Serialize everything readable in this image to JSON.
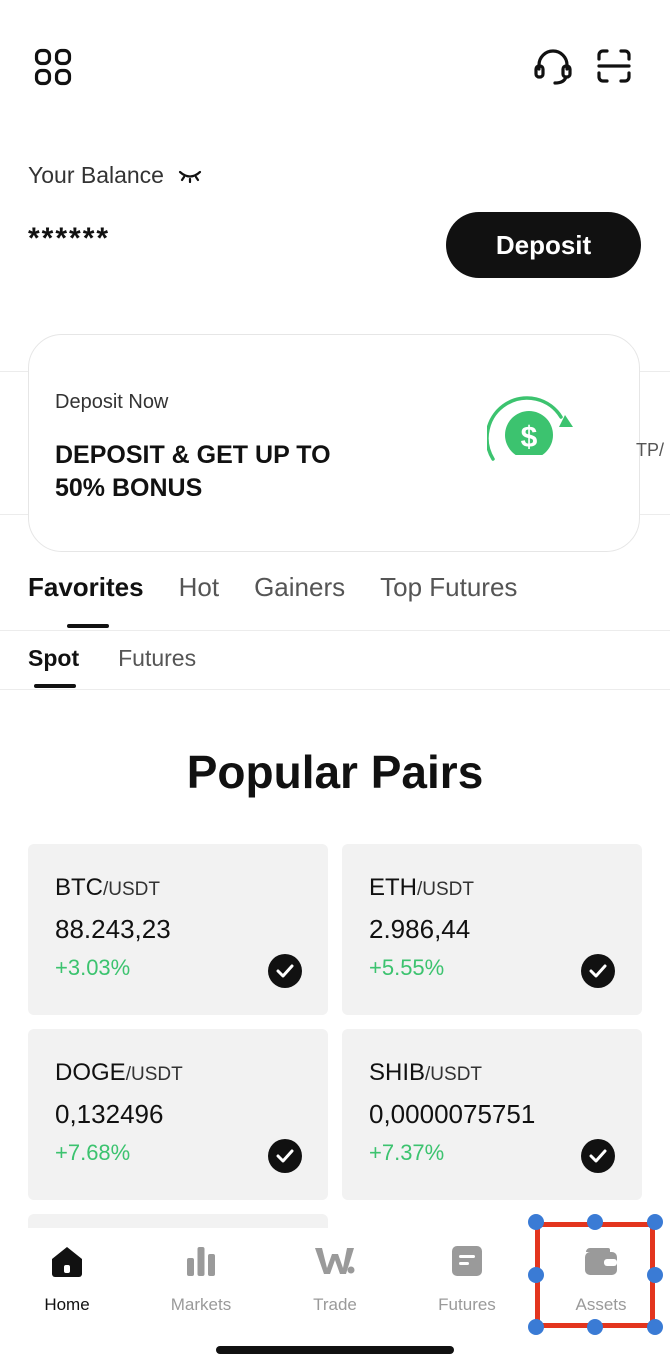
{
  "header": {
    "menu_icon": "grid-icon",
    "support_icon": "headset-icon",
    "scan_icon": "scan-icon"
  },
  "balance": {
    "label": "Your Balance",
    "hidden_value": "******",
    "visibility_icon": "eye-closed-icon",
    "deposit_label": "Deposit"
  },
  "promo": {
    "subtitle": "Deposit Now",
    "title": "DEPOSIT & GET UP TO 50% BONUS",
    "icon": "dollar-coin-icon",
    "next_edge_text": "TP/"
  },
  "tabs": [
    {
      "label": "Favorites",
      "active": true
    },
    {
      "label": "Hot",
      "active": false
    },
    {
      "label": "Gainers",
      "active": false
    },
    {
      "label": "Top Futures",
      "active": false
    }
  ],
  "subtabs": [
    {
      "label": "Spot",
      "active": true
    },
    {
      "label": "Futures",
      "active": false
    }
  ],
  "section_title": "Popular Pairs",
  "pairs": [
    {
      "base": "BTC",
      "quote": "/USDT",
      "price": "88.243,23",
      "change": "+3.03%",
      "selected": true
    },
    {
      "base": "ETH",
      "quote": "/USDT",
      "price": "2.986,44",
      "change": "+5.55%",
      "selected": true
    },
    {
      "base": "DOGE",
      "quote": "/USDT",
      "price": "0,132496",
      "change": "+7.68%",
      "selected": true
    },
    {
      "base": "SHIB",
      "quote": "/USDT",
      "price": "0,0000075751",
      "change": "+7.37%",
      "selected": true
    }
  ],
  "colors": {
    "positive": "#3cc36f",
    "primary": "#111111",
    "highlight": "#e3351e",
    "handle": "#3a7bd5"
  },
  "nav": [
    {
      "label": "Home",
      "icon": "home-icon",
      "active": true
    },
    {
      "label": "Markets",
      "icon": "bar-chart-icon",
      "active": false
    },
    {
      "label": "Trade",
      "icon": "trade-logo-icon",
      "active": false
    },
    {
      "label": "Futures",
      "icon": "document-icon",
      "active": false
    },
    {
      "label": "Assets",
      "icon": "wallet-icon",
      "active": false
    }
  ]
}
